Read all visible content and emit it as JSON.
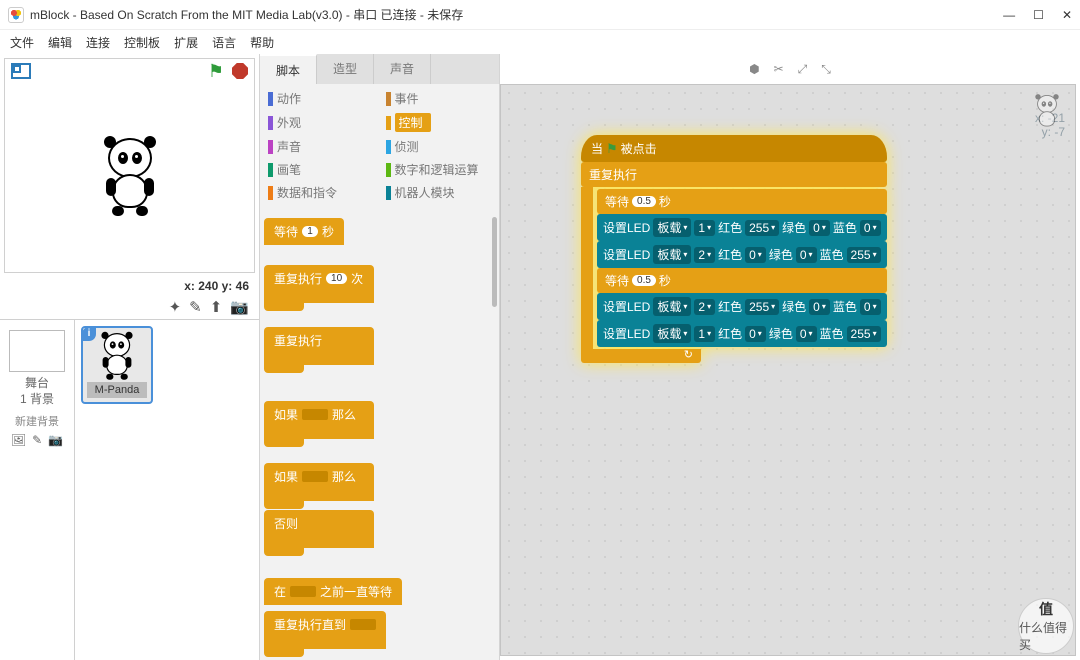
{
  "window": {
    "title": "mBlock - Based On Scratch From the MIT Media Lab(v3.0) - 串口 已连接 - 未保存"
  },
  "menu": [
    "文件",
    "编辑",
    "连接",
    "控制板",
    "扩展",
    "语言",
    "帮助"
  ],
  "stage": {
    "coord_label_x": "x:",
    "coord_x": "240",
    "coord_label_y": "y:",
    "coord_y": "46",
    "stage_label": "舞台",
    "backdrop_count": "1 背景",
    "new_backdrop": "新建背景",
    "sprite_name": "M-Panda"
  },
  "tabs": {
    "scripts": "脚本",
    "costumes": "造型",
    "sounds": "声音"
  },
  "categories": {
    "motion": {
      "label": "动作",
      "color": "#4a6cd4"
    },
    "looks": {
      "label": "外观",
      "color": "#8a55d7"
    },
    "sound": {
      "label": "声音",
      "color": "#bb42c3"
    },
    "pen": {
      "label": "画笔",
      "color": "#0e9a6c"
    },
    "data": {
      "label": "数据和指令",
      "color": "#ee7d16"
    },
    "events": {
      "label": "事件",
      "color": "#c88330"
    },
    "control": {
      "label": "控制",
      "color": "#e5a015"
    },
    "sensing": {
      "label": "侦测",
      "color": "#2ca5e2"
    },
    "operators": {
      "label": "数字和逻辑运算",
      "color": "#5cb712"
    },
    "robots": {
      "label": "机器人模块",
      "color": "#0a8296"
    }
  },
  "palette": {
    "wait": "等待",
    "wait_n": "1",
    "sec": "秒",
    "repeat": "重复执行",
    "repeat_n": "10",
    "times": "次",
    "forever": "重复执行",
    "if": "如果",
    "then": "那么",
    "else": "否则",
    "wait_until_a": "在",
    "wait_until_b": "之前一直等待",
    "repeat_until": "重复执行直到"
  },
  "script_info": {
    "x_label": "x:",
    "x": "-21",
    "y_label": "y:",
    "y": "-7"
  },
  "script": {
    "when": "当",
    "clicked": "被点击",
    "forever": "重复执行",
    "wait": "等待",
    "sec": "秒",
    "t": "0.5",
    "led": "设置LED",
    "board": "板载",
    "red": "红色",
    "green": "绿色",
    "blue": "蓝色",
    "r1": {
      "port": "1",
      "r": "255",
      "g": "0",
      "b": "0"
    },
    "r2": {
      "port": "2",
      "r": "0",
      "g": "0",
      "b": "255"
    },
    "r3": {
      "port": "2",
      "r": "255",
      "g": "0",
      "b": "0"
    },
    "r4": {
      "port": "1",
      "r": "0",
      "g": "0",
      "b": "255"
    }
  },
  "watermark": {
    "top": "值",
    "bottom": "什么值得买"
  }
}
